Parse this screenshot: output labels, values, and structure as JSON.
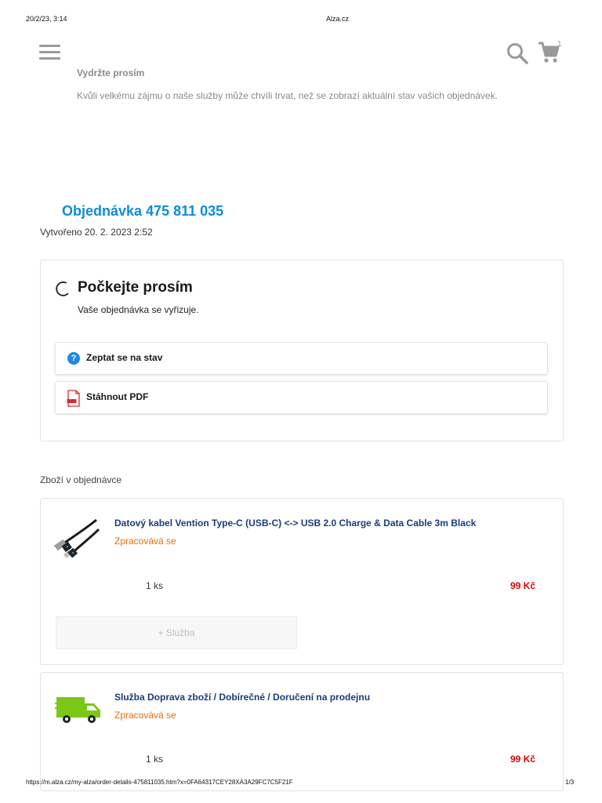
{
  "print_header": {
    "datetime": "20/2/23, 3:14",
    "title": "Alza.cz"
  },
  "topbar": {
    "menu_icon": "hamburger-menu-icon",
    "search_icon": "search-icon",
    "cart_icon": "shopping-cart-icon",
    "cart_count": "1"
  },
  "notice": {
    "title": "Vydržte prosím",
    "text": "Kvůli velkému zájmu o naše služby může chvíli trvat, než se zobrazí aktuální stav vašich objednávek."
  },
  "order": {
    "title": "Objednávka 475 811 035",
    "created": "Vytvořeno 20. 2. 2023 2:52"
  },
  "status": {
    "icon": "loading-spinner-icon",
    "title": "Počkejte prosím",
    "subtitle": "Vaše objednávka se vyřizuje.",
    "ask_button": "Zeptat se na stav",
    "pdf_button": "Stáhnout PDF"
  },
  "items_section": {
    "label": "Zboží v objednávce",
    "items": [
      {
        "name": "Datový kabel Vention Type-C (USB-C) <-> USB 2.0 Charge & Data Cable 3m Black",
        "status": "Zpracovává se",
        "qty": "1 ks",
        "price": "99 Kč",
        "image_icon": "usb-cable-icon",
        "service_button": "+ Služba"
      },
      {
        "name": "Služba Doprava zboží / Dobírečné / Doručení na prodejnu",
        "status": "Zpracovává se",
        "qty": "1 ks",
        "price": "99 Kč",
        "image_icon": "delivery-truck-icon"
      }
    ]
  },
  "print_footer": {
    "url": "https://m.alza.cz/my-alza/order-details-475811035.htm?x=0FA64317CEY28XA3A29FC7C5F21F",
    "page": "1/3"
  },
  "colors": {
    "accent": "#0d8cd6",
    "price": "#e00000",
    "status": "#ef6c00",
    "link": "#1a3c7a"
  }
}
